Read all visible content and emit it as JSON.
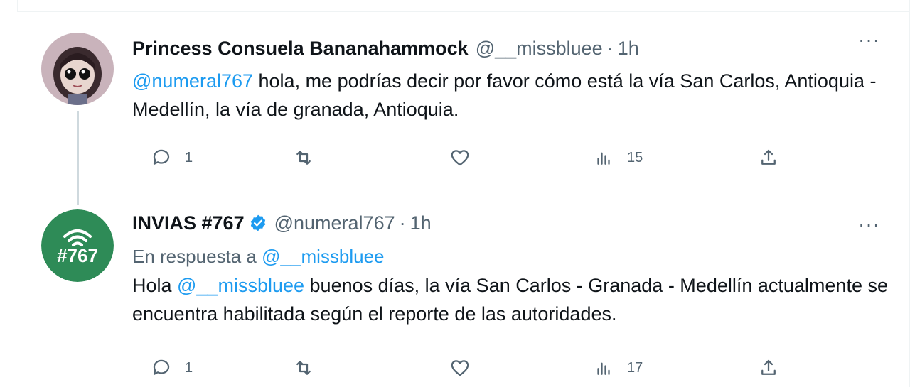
{
  "tweets": [
    {
      "author_name": "Princess Consuela Bananahammock",
      "handle": "@__missbluee",
      "separator": "·",
      "time": "1h",
      "more": "···",
      "verified": false,
      "body_mention": "@numeral767",
      "body_text": " hola, me podrías decir por favor cómo está la vía San Carlos, Antioquia - Medellín, la vía de granada, Antioquia.",
      "actions": {
        "replies": "1",
        "retweets": "",
        "likes": "",
        "views": "15"
      }
    },
    {
      "author_name": "INVIAS #767",
      "handle": "@numeral767",
      "separator": "·",
      "time": "1h",
      "more": "···",
      "verified": true,
      "reply_to_prefix": "En respuesta a ",
      "reply_to_handle": "@__missbluee",
      "body_prefix": "Hola ",
      "body_mention": "@__missbluee",
      "body_text": " buenos días, la vía San Carlos - Granada - Medellín actualmente se encuentra habilitada según el reporte de las autoridades.",
      "avatar_text": "#767",
      "actions": {
        "replies": "1",
        "retweets": "",
        "likes": "",
        "views": "17"
      }
    }
  ],
  "colors": {
    "accent": "#1d9bf0",
    "secondary_text": "#536471",
    "invias_green": "#2e8b57",
    "avatar1_bg": "#c9b3bb"
  },
  "icons": [
    "reply-icon",
    "retweet-icon",
    "like-icon",
    "views-icon",
    "share-icon",
    "verified-badge-icon",
    "more-icon"
  ]
}
